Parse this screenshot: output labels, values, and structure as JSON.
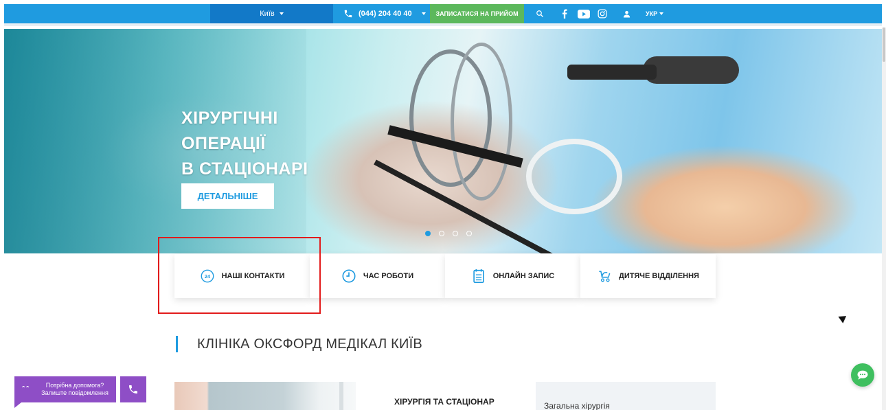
{
  "topbar": {
    "city": "Київ",
    "phone": "(044) 204 40 40",
    "book_button": "ЗАПИСАТИСЯ НА ПРИЙОМ",
    "language": "УКР",
    "accent_color": "#1f9be0",
    "book_color": "#5cb85c",
    "icons": [
      "phone-icon",
      "search-icon",
      "facebook-icon",
      "youtube-icon",
      "instagram-icon",
      "user-icon"
    ]
  },
  "hero": {
    "title_line1": "ХІРУРГІЧНІ",
    "title_line2": "ОПЕРАЦІЇ",
    "title_line3": "В СТАЦІОНАРІ",
    "button": "ДЕТАЛЬНІШЕ",
    "slides_total": 4,
    "active_slide": 1
  },
  "cards": [
    {
      "label": "НАШІ КОНТАКТИ",
      "icon": "phone-24-icon"
    },
    {
      "label": "ЧАС РОБОТИ",
      "icon": "clock-icon"
    },
    {
      "label": "ОНЛАЙН ЗАПИС",
      "icon": "calendar-icon"
    },
    {
      "label": "ДИТЯЧЕ ВІДДІЛЕННЯ",
      "icon": "stroller-icon"
    }
  ],
  "section": {
    "title": "КЛІНІКА ОКСФОРД МЕДІКАЛ КИЇВ",
    "subtitle": "ХІРУРГІЯ ТА СТАЦІОНАР",
    "side_item": "Загальна хірургія"
  },
  "widgets": {
    "help_line1": "Потрібна допомога?",
    "help_line2": "Залиште повідомлення",
    "help_color": "#8e4ec6",
    "chat_color": "#3fbf5f"
  }
}
